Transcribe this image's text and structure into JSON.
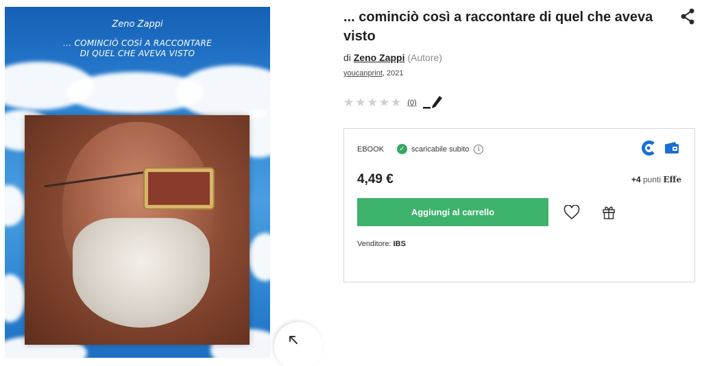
{
  "cover": {
    "author": "Zeno Zappi",
    "title_line1": "... COMINCIÒ COSÌ A RACCONTARE",
    "title_line2": "DI QUEL CHE AVEVA VISTO"
  },
  "product": {
    "title": "... cominciò così a raccontare di quel che aveva visto",
    "by_prefix": "di",
    "author": "Zeno Zappi",
    "author_role": "(Autore)",
    "publisher": "youcanprint",
    "year": ", 2021",
    "rating_count": "(0)",
    "rating_value": 0,
    "rating_max": 5
  },
  "purchase": {
    "format": "EBOOK",
    "availability": "scaricabile subito",
    "price": "4,49 €",
    "points_num": "+4",
    "points_label": " punti ",
    "points_brand": "Effe",
    "add_to_cart": "Aggiungi al carrello",
    "seller_label": "Venditore: ",
    "seller_name": "IBS"
  },
  "colors": {
    "cart_button": "#3db26b",
    "available_check": "#33a860",
    "pay_icon_blue": "#1b6fd1"
  },
  "icons": [
    "share-icon",
    "star-icon",
    "pen-icon",
    "check-icon",
    "info-icon",
    "kobo-icon",
    "wallet-icon",
    "heart-icon",
    "gift-icon",
    "expand-icon"
  ]
}
